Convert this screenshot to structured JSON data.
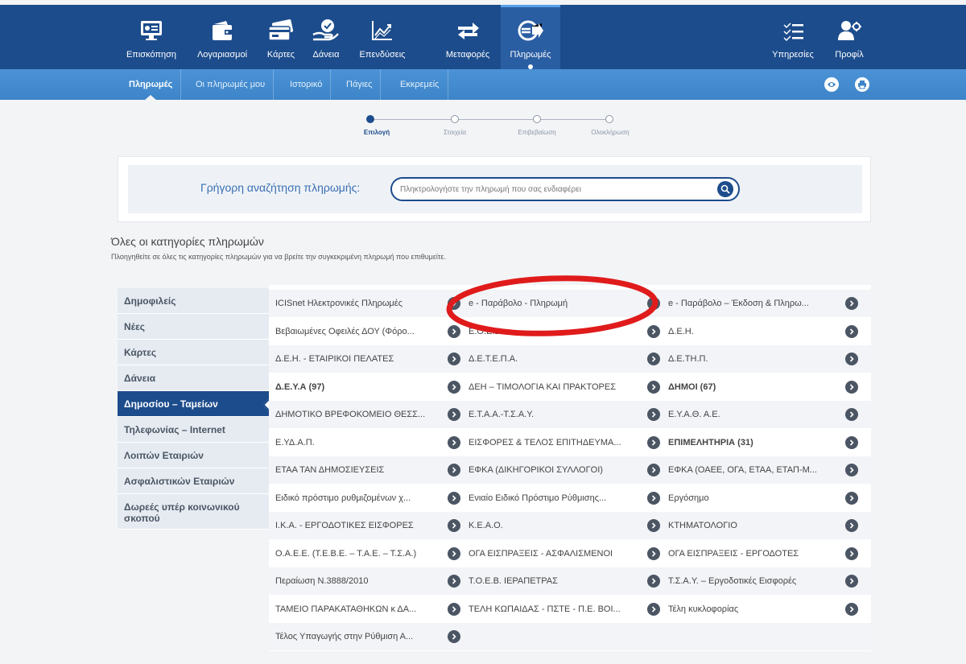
{
  "topnav": {
    "items": [
      {
        "label": "Επισκόπηση",
        "icon": "overview-icon"
      },
      {
        "label": "Λογαριασμοί",
        "icon": "wallet-icon"
      },
      {
        "label": "Κάρτες",
        "icon": "cards-icon"
      },
      {
        "label": "Δάνεια",
        "icon": "loans-icon"
      },
      {
        "label": "Επενδύσεις",
        "icon": "investments-icon"
      },
      {
        "label": "Μεταφορές",
        "icon": "transfers-icon"
      },
      {
        "label": "Πληρωμές",
        "icon": "payments-icon"
      },
      {
        "label": "Υπηρεσίες",
        "icon": "services-icon"
      },
      {
        "label": "Προφίλ",
        "icon": "profile-icon"
      }
    ],
    "active": "Πληρωμές"
  },
  "subnav": {
    "items": [
      "Πληρωμές",
      "Οι πληρωμές μου",
      "Ιστορικό",
      "Πάγιες",
      "Εκκρεμείς"
    ],
    "active": "Πληρωμές",
    "icons": [
      "eye-icon",
      "print-icon"
    ]
  },
  "stepper": {
    "steps": [
      "Επιλογή",
      "Στοιχεία",
      "Επιβεβαίωση",
      "Ολοκλήρωση"
    ],
    "current": "Επιλογή"
  },
  "search": {
    "label": "Γρήγορη αναζήτηση πληρωμής:",
    "placeholder": "Πληκτρολογήστε την πληρωμή που σας ενδιαφέρει"
  },
  "categories": {
    "title": "Όλες οι κατηγορίες πληρωμών",
    "subtitle": "Πλοηγηθείτε σε όλες τις κατηγορίες πληρωμών για να βρείτε την συγκεκριμένη πληρωμή που επιθυμείτε."
  },
  "sidebar": {
    "items": [
      "Δημοφιλείς",
      "Νέες",
      "Κάρτες",
      "Δάνεια",
      "Δημοσίου – Ταμείων",
      "Τηλεφωνίας – Internet",
      "Λοιπών Εταιριών",
      "Ασφαλιστικών Εταιριών",
      "Δωρεές υπέρ κοινωνικού σκοπού"
    ],
    "active": "Δημοσίου – Ταμείων"
  },
  "payments": {
    "rows": [
      [
        "ICISnet Ηλεκτρονικές Πληρωμές",
        "e - Παράβολο - Πληρωμή",
        "e - Παράβολο – Έκδοση & Πληρω..."
      ],
      [
        "Βεβαιωμένες Οφειλές ΔΟΥ (Φόρο...",
        "Ε.Ο.Ε.Β.",
        "Δ.Ε.Η."
      ],
      [
        "Δ.Ε.Η. - ΕΤΑΙΡΙΚΟΙ ΠΕΛΑΤΕΣ",
        "Δ.Ε.Τ.Ε.Π.Α.",
        "Δ.Ε.ΤΗ.Π."
      ],
      [
        "Δ.Ε.Υ.Α (97)",
        "ΔΕΗ – ΤΙΜΟΛΟΓΙΑ ΚΑΙ ΠΡΑΚΤΟΡΕΣ",
        "ΔΗΜΟΙ (67)"
      ],
      [
        "ΔΗΜΟΤΙΚΟ ΒΡΕΦΟΚΟΜΕΙΟ ΘΕΣΣ...",
        "Ε.Τ.Α.Α.-Τ.Σ.Α.Υ.",
        "Ε.Υ.Α.Θ. Α.Ε."
      ],
      [
        "Ε.ΥΔ.Α.Π.",
        "ΕΙΣΦΟΡΕΣ & ΤΕΛΟΣ ΕΠΙΤΗΔΕΥΜΑ...",
        "ΕΠΙΜΕΛΗΤΗΡΙΑ (31)"
      ],
      [
        "ΕΤΑΑ ΤΑΝ ΔΗΜΟΣΙΕΥΣΕΙΣ",
        "ΕΦΚΑ (ΔΙΚΗΓΟΡΙΚΟΙ ΣΥΛΛΟΓΟΙ)",
        "ΕΦΚΑ (ΟΑΕΕ, ΟΓΑ, ΕΤΑΑ, ΕΤΑΠ-Μ..."
      ],
      [
        "Ειδικό πρόστιμο ρυθμιζομένων χ...",
        "Ενιαίο Ειδικό Πρόστιμο Ρύθμισης...",
        "Εργόσημο"
      ],
      [
        "Ι.Κ.Α. - ΕΡΓΟΔΟΤΙΚΕΣ ΕΙΣΦΟΡΕΣ",
        "Κ.Ε.Α.Ο.",
        "ΚΤΗΜΑΤΟΛΟΓΙΟ"
      ],
      [
        "Ο.Α.Ε.Ε. (Τ.Ε.Β.Ε. – Τ.Α.Ε. – Τ.Σ.Α.)",
        "ΟΓΑ ΕΙΣΠΡΑΞΕΙΣ - ΑΣΦΑΛΙΣΜΕΝΟΙ",
        "ΟΓΑ ΕΙΣΠΡΑΞΕΙΣ - ΕΡΓΟΔΟΤΕΣ"
      ],
      [
        "Περαίωση Ν.3888/2010",
        "Τ.Ο.Ε.Β. ΙΕΡΑΠΕΤΡΑΣ",
        "Τ.Σ.Α.Υ. – Εργοδοτικές Εισφορές"
      ],
      [
        "ΤΑΜΕΙΟ ΠΑΡΑΚΑΤΑΘΗΚΩΝ κ ΔΑ...",
        "ΤΕΛΗ ΚΩΠΑΙΔΑΣ - ΠΣΤΕ - Π.Ε. ΒΟΙ...",
        "Τέλη κυκλοφορίας"
      ],
      [
        "Τέλος Υπαγωγής στην Ρύθμιση Α...",
        "",
        ""
      ]
    ],
    "bold_items": [
      "Δ.Ε.Υ.Α (97)",
      "ΔΗΜΟΙ (67)",
      "ΕΠΙΜΕΛΗΤΗΡΙΑ (31)"
    ]
  },
  "colors": {
    "navy": "#1c4c8c",
    "subnav": "#4b93d6",
    "annotation": "#e01b1b"
  }
}
